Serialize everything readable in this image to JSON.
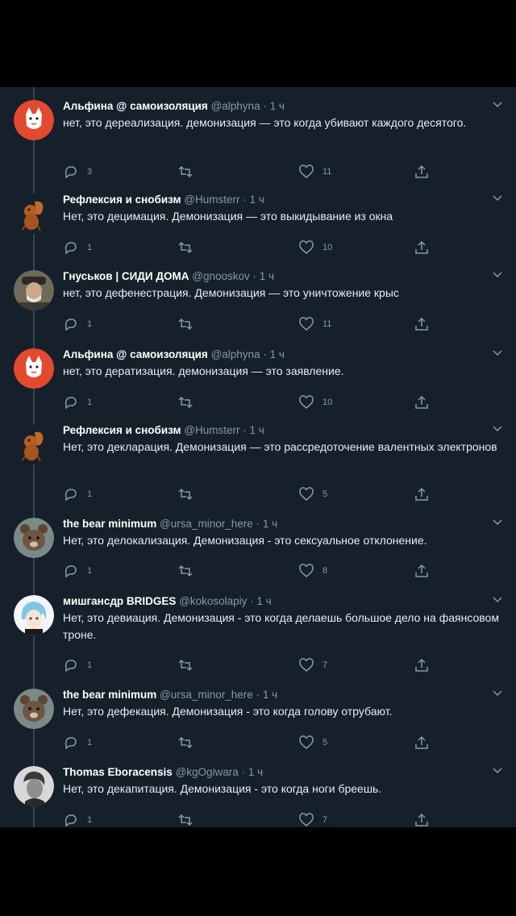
{
  "tweets": [
    {
      "name": "Альфина @ самоизоляция",
      "handle": "@alphyna",
      "time": "1 ч",
      "text": "нет, это дереализация. демонизация — это когда убивают каждого десятого.",
      "replies": "3",
      "likes": "11",
      "avatar": "fox-avatar"
    },
    {
      "name": "Рефлексия и снобизм",
      "handle": "@Humsterr",
      "time": "1 ч",
      "text": "Нет, это децимация. Демонизация — это выкидывание из окна",
      "replies": "1",
      "likes": "10",
      "avatar": "squirrel-avatar"
    },
    {
      "name": "Гнуськов | СИДИ ДОМА",
      "handle": "@gnooskov",
      "time": "1 ч",
      "text": "нет, это дефенестрация. Демонизация — это уничтожение крыс",
      "replies": "1",
      "likes": "11",
      "avatar": "man-photo-avatar"
    },
    {
      "name": "Альфина @ самоизоляция",
      "handle": "@alphyna",
      "time": "1 ч",
      "text": "нет, это дератизация. демонизация — это заявление.",
      "replies": "1",
      "likes": "10",
      "avatar": "fox-avatar"
    },
    {
      "name": "Рефлексия и снобизм",
      "handle": "@Humsterr",
      "time": "1 ч",
      "text": "Нет, это декларация. Демонизация — это рассредоточение валентных электронов",
      "replies": "1",
      "likes": "5",
      "avatar": "squirrel-avatar"
    },
    {
      "name": "the bear minimum",
      "handle": "@ursa_minor_here",
      "time": "1 ч",
      "text": "Нет, это делокализация. Демонизация - это сексуальное отклонение.",
      "replies": "1",
      "likes": "8",
      "avatar": "bear-avatar"
    },
    {
      "name": "мишгансдр BRIDGES",
      "handle": "@kokosolapiy",
      "time": "1 ч",
      "text": "Нет, это девиация. Демонизация - это когда делаешь большое дело на фаянсовом троне.",
      "replies": "1",
      "likes": "7",
      "avatar": "anime-avatar"
    },
    {
      "name": "the bear minimum",
      "handle": "@ursa_minor_here",
      "time": "1 ч",
      "text": "Нет, это дефекация. Демонизация - это когда голову отрубают.",
      "replies": "1",
      "likes": "5",
      "avatar": "bear-avatar"
    },
    {
      "name": "Thomas Eboracensis",
      "handle": "@kgOgiwara",
      "time": "1 ч",
      "text": "Нет, это декапитация. Демонизация - это когда ноги бреешь.",
      "replies": "1",
      "likes": "7",
      "avatar": "portrait-avatar"
    }
  ],
  "colors": {
    "background": "#15202b",
    "text": "#e8ecef",
    "muted": "#8899a6",
    "thread_line": "#38444d"
  }
}
